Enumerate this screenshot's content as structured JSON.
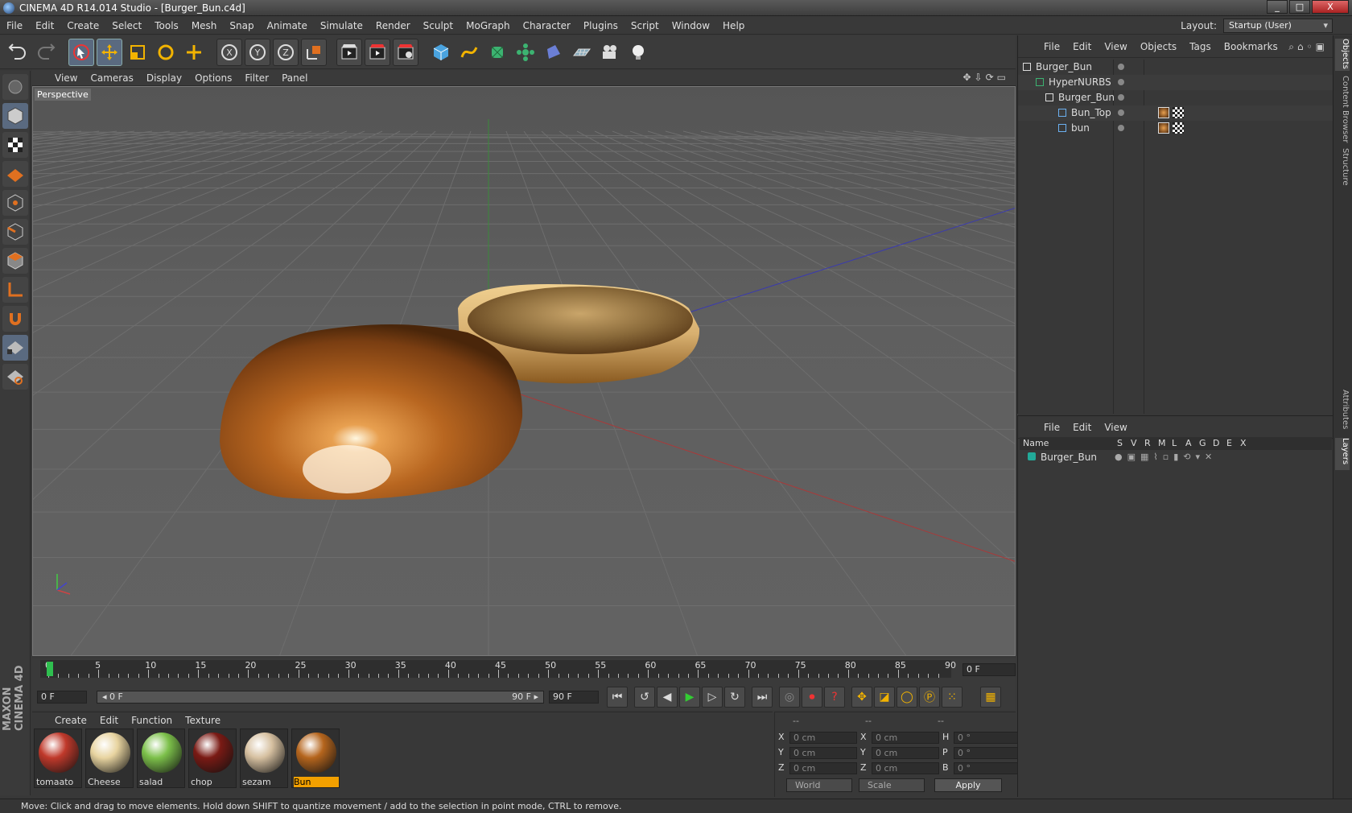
{
  "window": {
    "title": "CINEMA 4D R14.014 Studio - [Burger_Bun.c4d]",
    "min": "_",
    "max": "□",
    "close": "X"
  },
  "menu": [
    "File",
    "Edit",
    "Create",
    "Select",
    "Tools",
    "Mesh",
    "Snap",
    "Animate",
    "Simulate",
    "Render",
    "Sculpt",
    "MoGraph",
    "Character",
    "Plugins",
    "Script",
    "Window",
    "Help"
  ],
  "layout": {
    "label": "Layout:",
    "value": "Startup (User)"
  },
  "viewport": {
    "menu": [
      "View",
      "Cameras",
      "Display",
      "Options",
      "Filter",
      "Panel"
    ],
    "label": "Perspective"
  },
  "timeline": {
    "ticks": [
      "0",
      "5",
      "10",
      "15",
      "20",
      "25",
      "30",
      "35",
      "40",
      "45",
      "50",
      "55",
      "60",
      "65",
      "70",
      "75",
      "80",
      "85",
      "90"
    ],
    "current_frame": "0 F"
  },
  "transport": {
    "start_field": "0 F",
    "slider_left": "◂ 0 F",
    "slider_right": "90 F ▸",
    "end_field": "90 F"
  },
  "materials": {
    "menu": [
      "Create",
      "Edit",
      "Function",
      "Texture"
    ],
    "items": [
      {
        "name": "tomaato",
        "color": "#c0392b"
      },
      {
        "name": "Cheese",
        "color": "#e8d4a0"
      },
      {
        "name": "salad",
        "color": "#7cc04a"
      },
      {
        "name": "chop",
        "color": "#7a1a14"
      },
      {
        "name": "sezam",
        "color": "#d6c0a0"
      },
      {
        "name": "Bun",
        "color": "#b5651d",
        "selected": true
      }
    ]
  },
  "coords": {
    "headers": [
      "--",
      "--",
      "--"
    ],
    "rows": [
      {
        "l1": "X",
        "v1": "0 cm",
        "l2": "X",
        "v2": "0 cm",
        "l3": "H",
        "v3": "0 °"
      },
      {
        "l1": "Y",
        "v1": "0 cm",
        "l2": "Y",
        "v2": "0 cm",
        "l3": "P",
        "v3": "0 °"
      },
      {
        "l1": "Z",
        "v1": "0 cm",
        "l2": "Z",
        "v2": "0 cm",
        "l3": "B",
        "v3": "0 °"
      }
    ],
    "mode": "World",
    "scale": "Scale",
    "apply": "Apply"
  },
  "objects": {
    "menu": [
      "File",
      "Edit",
      "View",
      "Objects",
      "Tags",
      "Bookmarks"
    ],
    "tree": [
      {
        "name": "Burger_Bun"
      },
      {
        "name": "HyperNURBS"
      },
      {
        "name": "Burger_Bun"
      },
      {
        "name": "Bun_Top"
      },
      {
        "name": "bun"
      }
    ]
  },
  "layers": {
    "menu": [
      "File",
      "Edit",
      "View"
    ],
    "columns": [
      "Name",
      "S",
      "V",
      "R",
      "M",
      "L",
      "A",
      "G",
      "D",
      "E",
      "X"
    ],
    "rows": [
      {
        "name": "Burger_Bun"
      }
    ]
  },
  "sidetabs": [
    "Objects",
    "Content Browser",
    "Structure",
    "Attributes",
    "Layers"
  ],
  "status": "Move: Click and drag to move elements. Hold down SHIFT to quantize movement / add to the selection in point mode, CTRL to remove.",
  "brand": "MAXON CINEMA 4D"
}
